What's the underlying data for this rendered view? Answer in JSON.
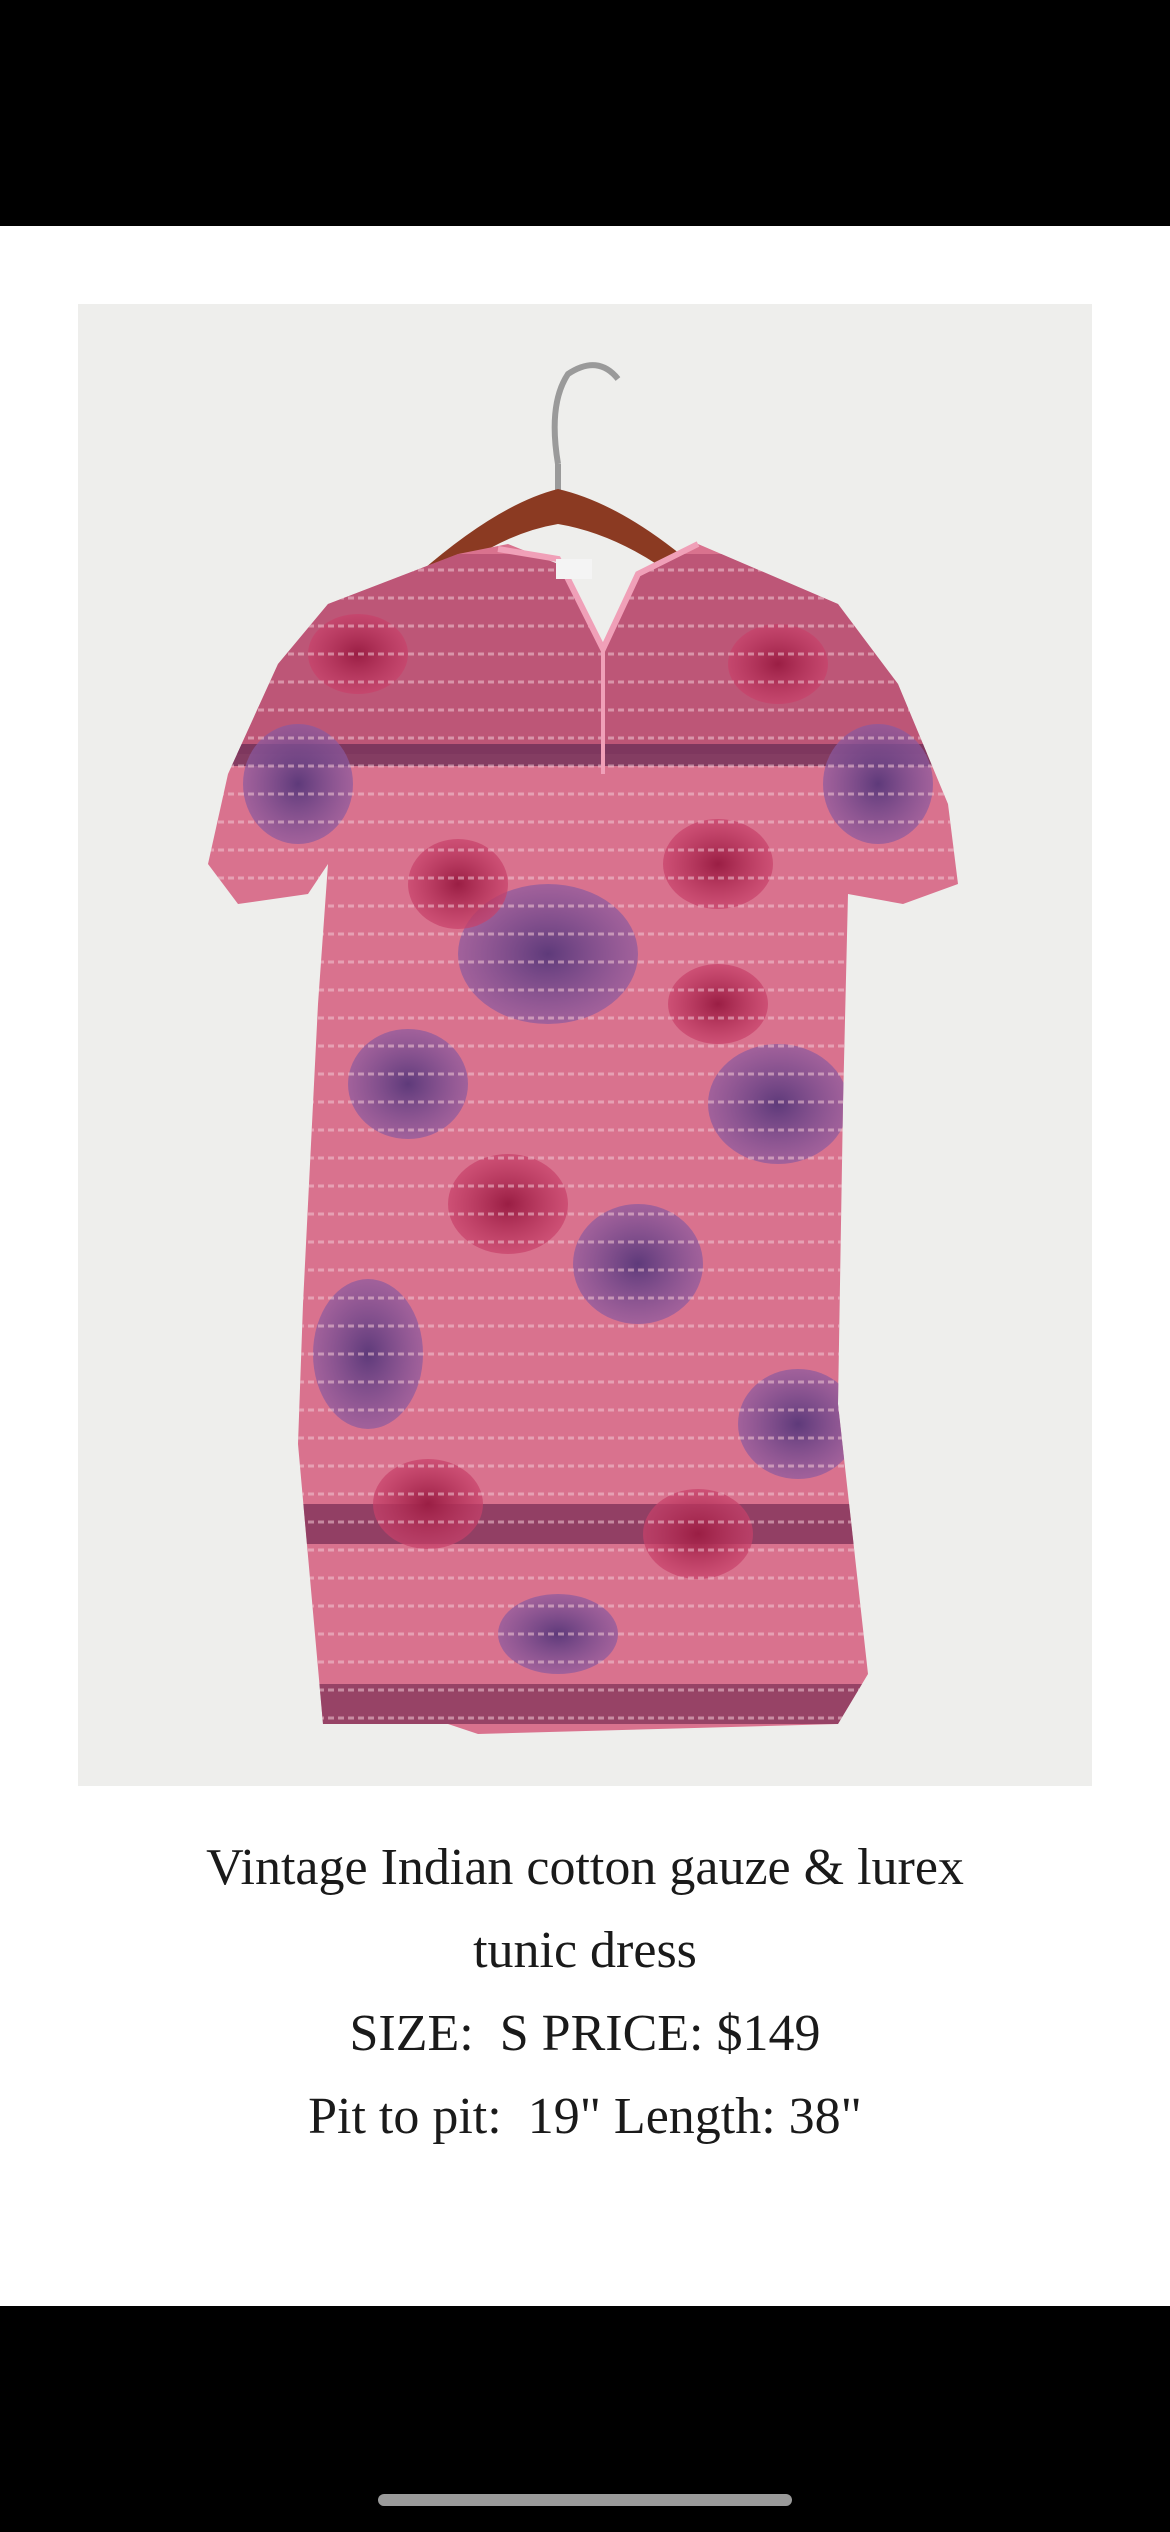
{
  "product": {
    "image_alt": "Vintage pink and purple floral tunic dress on a wooden hanger",
    "title_line1": "Vintage Indian cotton gauze & lurex",
    "title_line2": "tunic dress",
    "size_price": "SIZE:  S PRICE: $149",
    "measurements": "Pit to pit:  19\" Length: 38\""
  },
  "colors": {
    "dress_base": "#d9728e",
    "dress_deep": "#b8345a",
    "dress_purple": "#7a4a8f",
    "wall": "#eeeeec",
    "hanger_wood": "#8b3a22"
  }
}
